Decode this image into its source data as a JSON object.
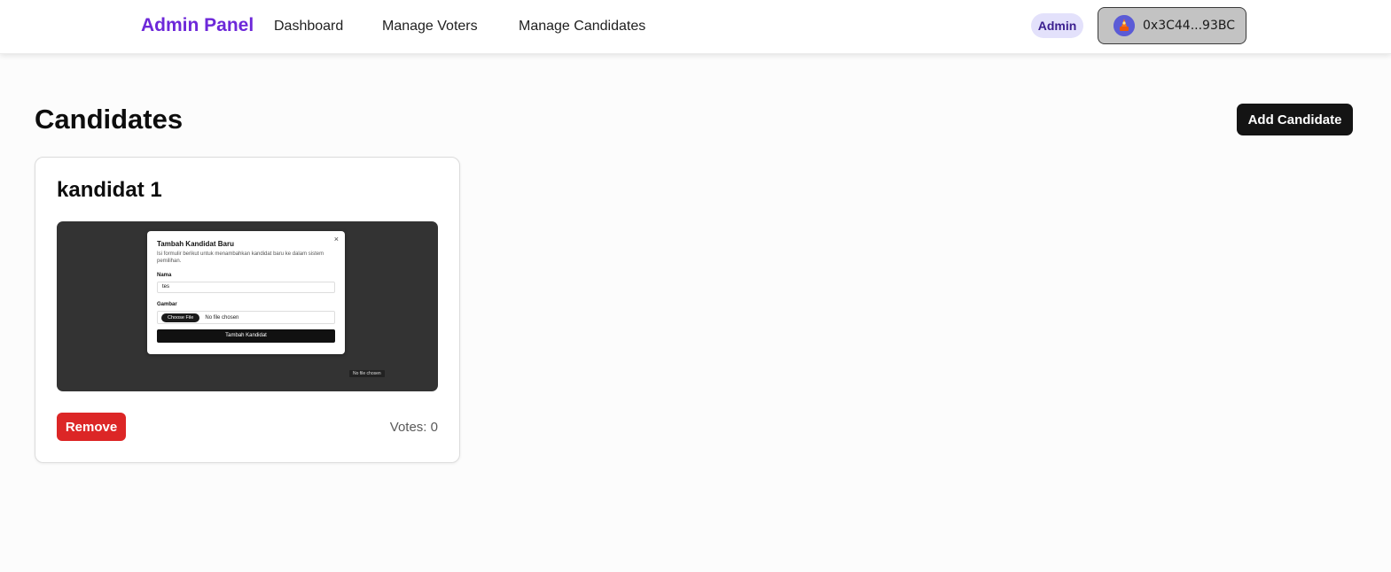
{
  "navbar": {
    "brand": "Admin Panel",
    "links": [
      {
        "label": "Dashboard"
      },
      {
        "label": "Manage Voters"
      },
      {
        "label": "Manage Candidates"
      }
    ],
    "role_badge": "Admin",
    "wallet": {
      "address": "0x3C44...93BC",
      "avatar_icon": "wallet-avatar-icon"
    }
  },
  "main": {
    "title": "Candidates",
    "add_button": "Add Candidate",
    "candidates": [
      {
        "name": "kandidat 1",
        "image": {
          "modal_title": "Tambah Kandidat Baru",
          "modal_desc": "Isi formulir berikut untuk menambahkan kandidat baru ke dalam sistem pemilihan.",
          "close_glyph": "×",
          "name_label": "Nama",
          "name_value": "tes",
          "image_label": "Gambar",
          "choose_file": "Choose File",
          "no_file": "No file chosen",
          "submit": "Tambah Kandidat",
          "tooltip": "No file chosen"
        },
        "remove_label": "Remove",
        "votes_text": "Votes: 0"
      }
    ]
  },
  "colors": {
    "brand": "#6d28d9",
    "danger": "#dc2626",
    "primary_button": "#141414",
    "badge_bg": "#e3e1fb"
  }
}
